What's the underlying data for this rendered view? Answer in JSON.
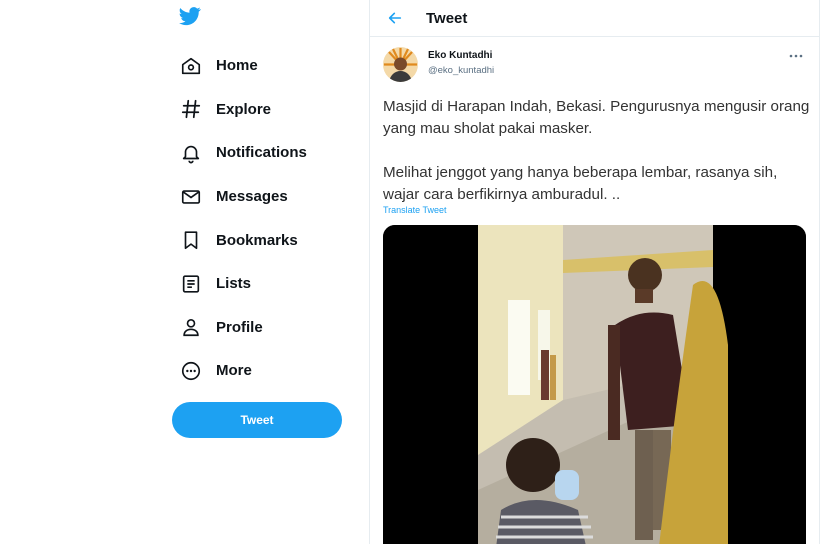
{
  "sidebar": {
    "logo": "twitter-bird-icon",
    "items": [
      {
        "label": "Home",
        "icon": "home-icon"
      },
      {
        "label": "Explore",
        "icon": "hashtag-icon"
      },
      {
        "label": "Notifications",
        "icon": "bell-icon"
      },
      {
        "label": "Messages",
        "icon": "envelope-icon"
      },
      {
        "label": "Bookmarks",
        "icon": "bookmark-icon"
      },
      {
        "label": "Lists",
        "icon": "list-icon"
      },
      {
        "label": "Profile",
        "icon": "person-icon"
      },
      {
        "label": "More",
        "icon": "more-circle-icon"
      }
    ],
    "tweet_button": "Tweet"
  },
  "header": {
    "title": "Tweet"
  },
  "tweet": {
    "author_name": "Eko Kuntadhi",
    "author_handle": "@eko_kuntadhi",
    "text": "Masjid di Harapan Indah, Bekasi. Pengurusnya mengusir orang yang mau sholat pakai masker.\n\nMelihat jenggot yang hanya beberapa lembar, rasanya sih, wajar cara berfikirnya amburadul. ..",
    "translate_label": "Translate Tweet"
  },
  "colors": {
    "accent": "#1da1f2",
    "text": "#0f1419",
    "muted": "#5b7083",
    "border": "#e6ecf0"
  }
}
